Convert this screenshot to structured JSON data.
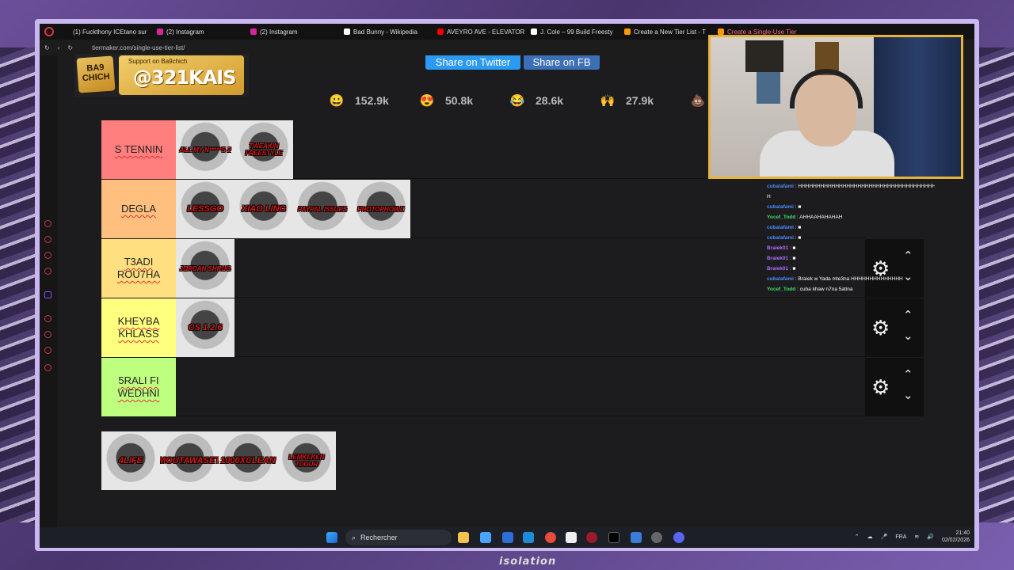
{
  "browser": {
    "tabs": [
      {
        "label": "(1) Fuckthony ICEtano sur",
        "fav": "#111"
      },
      {
        "label": "(2) Instagram",
        "fav": "#d6249f"
      },
      {
        "label": "(2) Instagram",
        "fav": "#d6249f"
      },
      {
        "label": "Bad Bunny - Wikipedia",
        "fav": "#fff"
      },
      {
        "label": "AVEYRO AVE - ELEVATOR",
        "fav": "#e00"
      },
      {
        "label": "J. Cole – 99 Build Freesty",
        "fav": "#fff"
      },
      {
        "label": "Create a New Tier List - T",
        "fav": "#f90"
      },
      {
        "label": "Create a Single-Use Tier",
        "fav": "#f90"
      }
    ],
    "url": "tiermaker.com/single-use-tier-list/"
  },
  "share": {
    "twitter": "Share on Twitter",
    "fb": "Share on FB"
  },
  "reactions": [
    {
      "icon": "grinning-face-icon",
      "glyph": "😀",
      "count": "152.9k"
    },
    {
      "icon": "heart-eyes-icon",
      "glyph": "😍",
      "count": "50.8k"
    },
    {
      "icon": "tears-of-joy-icon",
      "glyph": "😂",
      "count": "28.6k"
    },
    {
      "icon": "raising-hands-icon",
      "glyph": "🙌",
      "count": "27.9k"
    },
    {
      "icon": "pile-of-poo-icon",
      "glyph": "💩",
      "count": "69."
    }
  ],
  "overlay": {
    "badge": "BA9\nCHICH",
    "support": "Support on Ba9chich",
    "handle": "@321KAIS"
  },
  "tiers": [
    {
      "label": "S TENNIN",
      "color": "#ff7f7f",
      "items": [
        "ALL MY N*****S 2",
        "TWEAKIN FREESTYLE"
      ]
    },
    {
      "label": "DEGLA",
      "color": "#ffbf7f",
      "items": [
        "LESSGO",
        "XIAO LING",
        "PAYPAL ISSUES",
        "PHOTOPHOBIC"
      ]
    },
    {
      "label": "T3ADI ROU7HA",
      "color": "#ffdf7f",
      "items": [
        "JORDAN SHRUG"
      ]
    },
    {
      "label": "KHEYBA KHLASS",
      "color": "#ffff7f",
      "items": [
        "CS 1.2.6"
      ]
    },
    {
      "label": "5RALI FI WEDHNI",
      "color": "#bfff7f",
      "items": []
    }
  ],
  "pool": [
    "4LIFE",
    "MOUTAWASET",
    "1000XCLEAN",
    "LEMKEKEN TDOUR"
  ],
  "chat": [
    {
      "user": "cubalafami",
      "color": "#4a8cff",
      "msg": "HHHHHHHHHHHHHHHHHHHHHHHHHHHHHHHHHHHHHHHHHHHHH"
    },
    {
      "user": "",
      "color": "#fff",
      "msg": "H"
    },
    {
      "user": "cubalafami",
      "color": "#4a8cff",
      "msg": "■"
    },
    {
      "user": "Yocef_Todd",
      "color": "#3fdc6a",
      "msg": "AHHAAHAHAHAH"
    },
    {
      "user": "cubalafami",
      "color": "#4a8cff",
      "msg": "■"
    },
    {
      "user": "cubalafami",
      "color": "#4a8cff",
      "msg": "■"
    },
    {
      "user": "Braiek01",
      "color": "#b46bff",
      "msg": "■"
    },
    {
      "user": "Braiek01",
      "color": "#b46bff",
      "msg": "■"
    },
    {
      "user": "Braiek01",
      "color": "#b46bff",
      "msg": "■"
    },
    {
      "user": "cubalafami",
      "color": "#4a8cff",
      "msg": "Braiek w Yada mte3na HHHHHHHHHHHHHH"
    },
    {
      "user": "Yocef_Todd",
      "color": "#3fdc6a",
      "msg": "cuba khaw n7na 5atina"
    }
  ],
  "taskbar": {
    "search": "Rechercher",
    "lang": "FRA",
    "time": "21:40",
    "date": "02/02/2026"
  },
  "footer_logo": "isolation"
}
